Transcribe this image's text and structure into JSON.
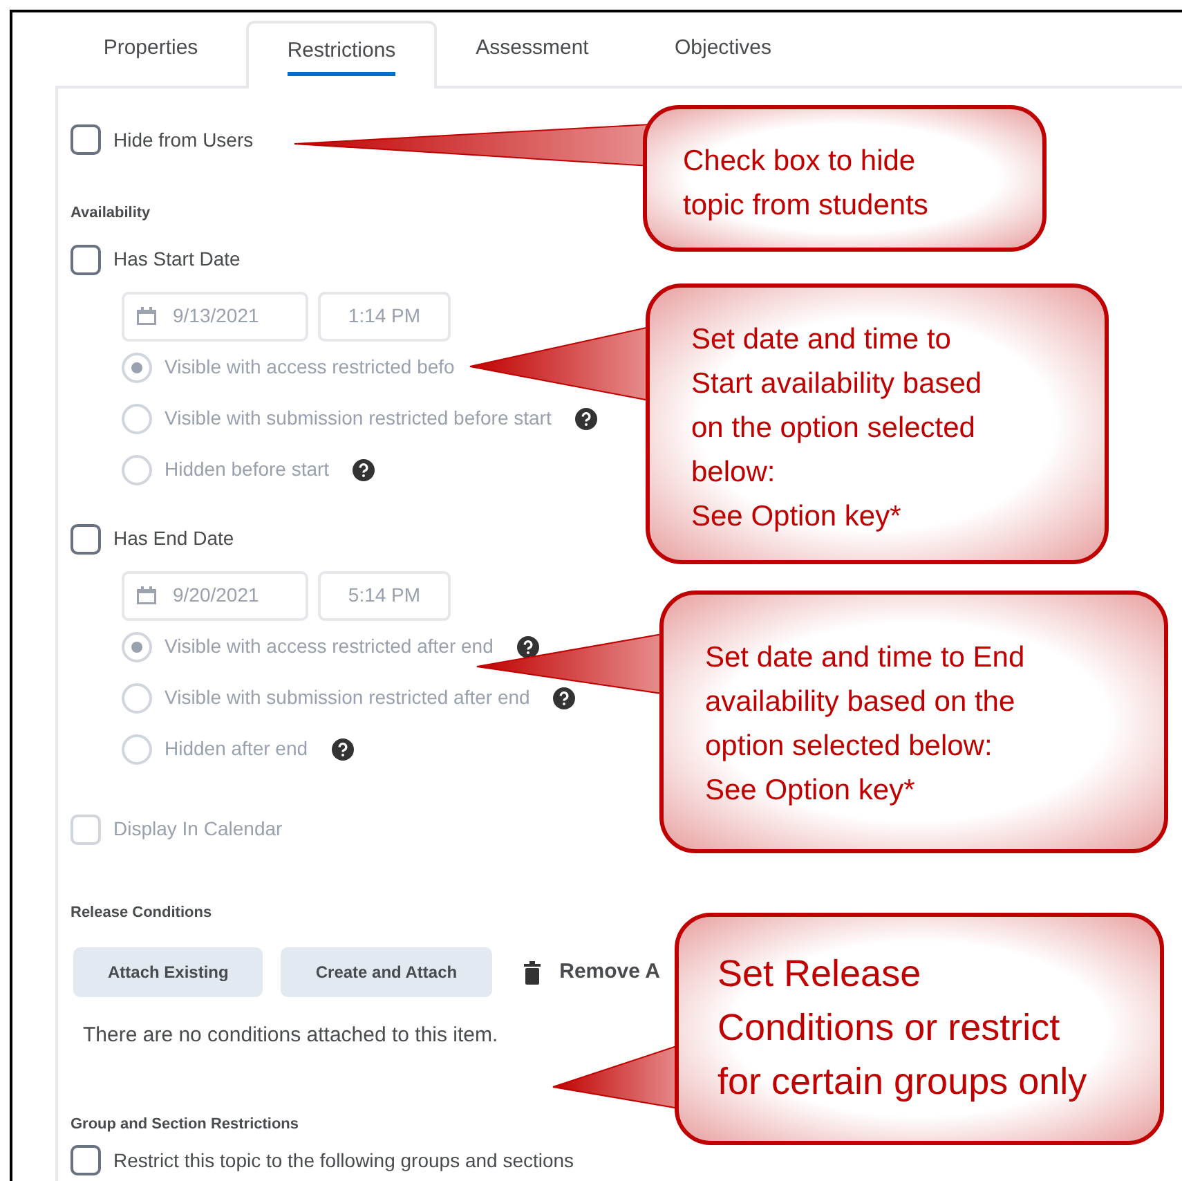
{
  "tabs": [
    {
      "label": "Properties",
      "selected": false
    },
    {
      "label": "Restrictions",
      "selected": true
    },
    {
      "label": "Assessment",
      "selected": false
    },
    {
      "label": "Objectives",
      "selected": false
    }
  ],
  "hide_from_users": {
    "label": "Hide from Users",
    "checked": false
  },
  "availability": {
    "heading": "Availability",
    "start": {
      "label": "Has Start Date",
      "checked": false,
      "date": "9/13/2021",
      "time": "1:14 PM",
      "options": [
        {
          "label": "Visible with access restricted befo",
          "selected": true,
          "help": false
        },
        {
          "label": "Visible with submission restricted before start",
          "selected": false,
          "help": true
        },
        {
          "label": "Hidden before start",
          "selected": false,
          "help": true
        }
      ]
    },
    "end": {
      "label": "Has End Date",
      "checked": false,
      "date": "9/20/2021",
      "time": "5:14 PM",
      "options": [
        {
          "label": "Visible with access restricted after end",
          "selected": true,
          "help": true
        },
        {
          "label": "Visible with submission restricted after end",
          "selected": false,
          "help": true
        },
        {
          "label": "Hidden after end",
          "selected": false,
          "help": true
        }
      ]
    }
  },
  "display_in_calendar": {
    "label": "Display In Calendar",
    "checked": false,
    "disabled": true
  },
  "release_conditions": {
    "heading": "Release Conditions",
    "buttons": [
      "Attach Existing",
      "Create and Attach"
    ],
    "remove_label": "Remove A",
    "empty_text": "There are no conditions attached to this item."
  },
  "group_restrictions": {
    "heading": "Group and Section Restrictions",
    "restrict": {
      "label": "Restrict this topic to the following groups and sections",
      "checked": false
    }
  },
  "callouts": [
    {
      "text": "Check box to hide\ntopic from students"
    },
    {
      "text": "Set date and time to\nStart availability based\non the option selected\nbelow:\nSee Option key*"
    },
    {
      "text": "Set date and time to End\navailability based on the\noption selected below:\nSee Option key*"
    },
    {
      "text": "Set Release\nConditions or restrict\nfor certain groups only"
    }
  ]
}
